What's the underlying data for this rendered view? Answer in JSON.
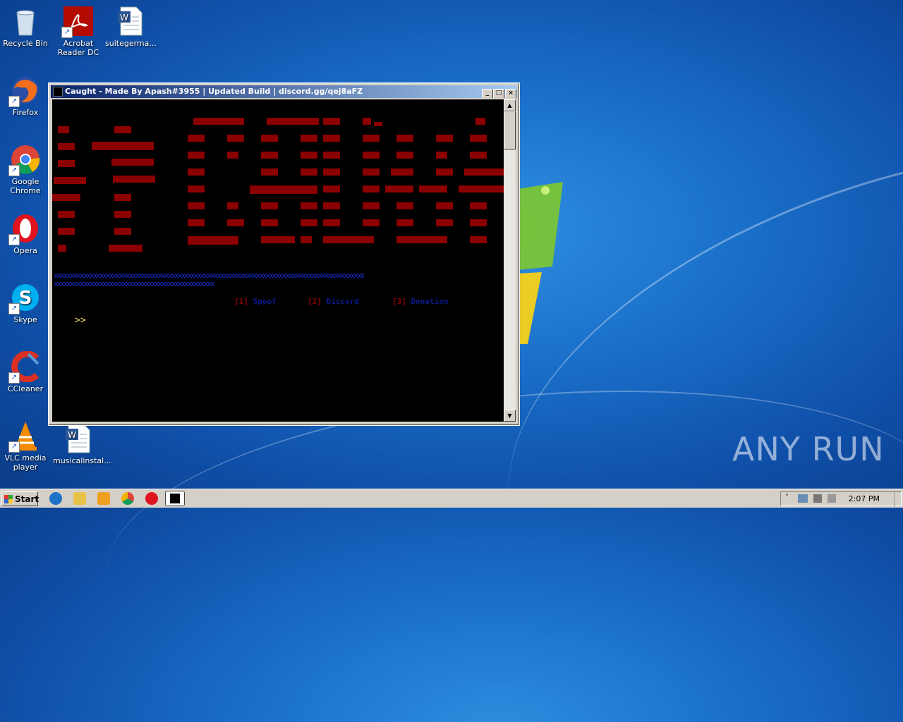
{
  "desktop_icons": [
    {
      "label": "Recycle Bin",
      "icon": "recycle-bin-icon"
    },
    {
      "label": "Acrobat Reader DC",
      "icon": "acrobat-icon"
    },
    {
      "label": "suitegerma...",
      "icon": "word-document-icon"
    },
    {
      "label": "Firefox",
      "icon": "firefox-icon"
    },
    {
      "label": "Google Chrome",
      "icon": "chrome-icon"
    },
    {
      "label": "Opera",
      "icon": "opera-icon"
    },
    {
      "label": "Skype",
      "icon": "skype-icon"
    },
    {
      "label": "CCleaner",
      "icon": "ccleaner-icon"
    },
    {
      "label": "VLC media player",
      "icon": "vlc-icon"
    },
    {
      "label": "musicalinstal...",
      "icon": "word-document-icon"
    }
  ],
  "console": {
    "title": "Caught - Made By Apash#3955 | Updated Build | discord.gg/qej8aFZ",
    "menu": [
      {
        "num": "[1]",
        "label": "Spoof"
      },
      {
        "num": "[2]",
        "label": "Discord"
      },
      {
        "num": "[3]",
        "label": "Donation"
      }
    ],
    "prompt": ">>",
    "separator": "xxxxxxxxxxxxxxxxxxxxxxxxxxxxxxxxxxxxxxxxxxxxxxxxxxxxxxxxxxxxxxxxxxxxxxxxxxxxxxxxxxxxxxxxxxxxxxx",
    "separator2": "xxxxxxxxxxxxxxxxxxxxxxxxxxxxxxxxxxxxxxxxxxxxxxxxx"
  },
  "taskbar": {
    "start_label": "Start",
    "clock": "2:07 PM"
  },
  "watermark": "ANY RUN",
  "colors": {
    "console_block": "#8b0000",
    "separator": "#1a2fd0",
    "prompt": "#f5e36b"
  }
}
